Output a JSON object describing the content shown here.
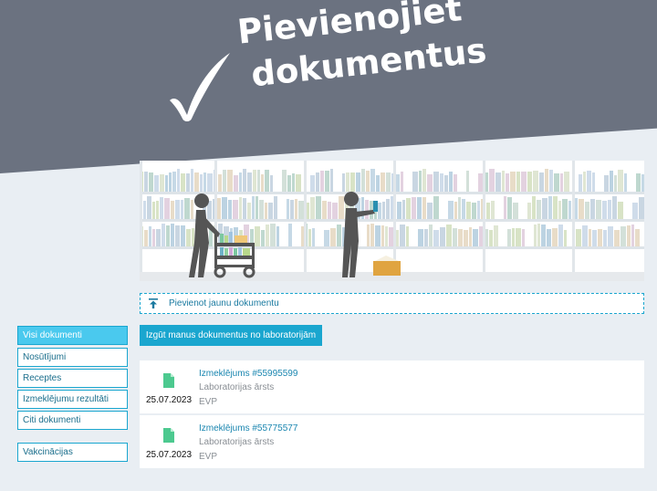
{
  "banner": {
    "title_line1": "Pievienojiet",
    "title_line2": "dokumentus",
    "icon": "checkmark-icon",
    "color": "#6b7280"
  },
  "illustration": {
    "description_icon": "library-illustration"
  },
  "actions": {
    "add_document_label": "Pievienot jaunu dokumentu",
    "add_document_icon": "upload-icon",
    "fetch_lab_label": "Izgūt manus dokumentus no laboratorijām"
  },
  "sidebar": {
    "items": [
      {
        "label": "Visi dokumenti",
        "active": true
      },
      {
        "label": "Nosūtījumi",
        "active": false
      },
      {
        "label": "Receptes",
        "active": false
      },
      {
        "label": "Izmeklējumu rezultāti",
        "active": false
      },
      {
        "label": "Citi dokumenti",
        "active": false
      },
      {
        "label": "Vakcinācijas",
        "active": false
      }
    ]
  },
  "documents": [
    {
      "date": "25.07.2023",
      "title": "Izmeklējums #55995599",
      "role": "Laboratorijas ārsts",
      "org": "EVP",
      "icon": "file-icon"
    },
    {
      "date": "25.07.2023",
      "title": "Izmeklējums #55775577",
      "role": "Laboratorijas ārsts",
      "org": "EVP",
      "icon": "file-icon"
    }
  ],
  "colors": {
    "accent": "#1aa6cf",
    "active_tab": "#4ac9ee",
    "file_icon": "#4cc98f",
    "background": "#e9eef3"
  }
}
